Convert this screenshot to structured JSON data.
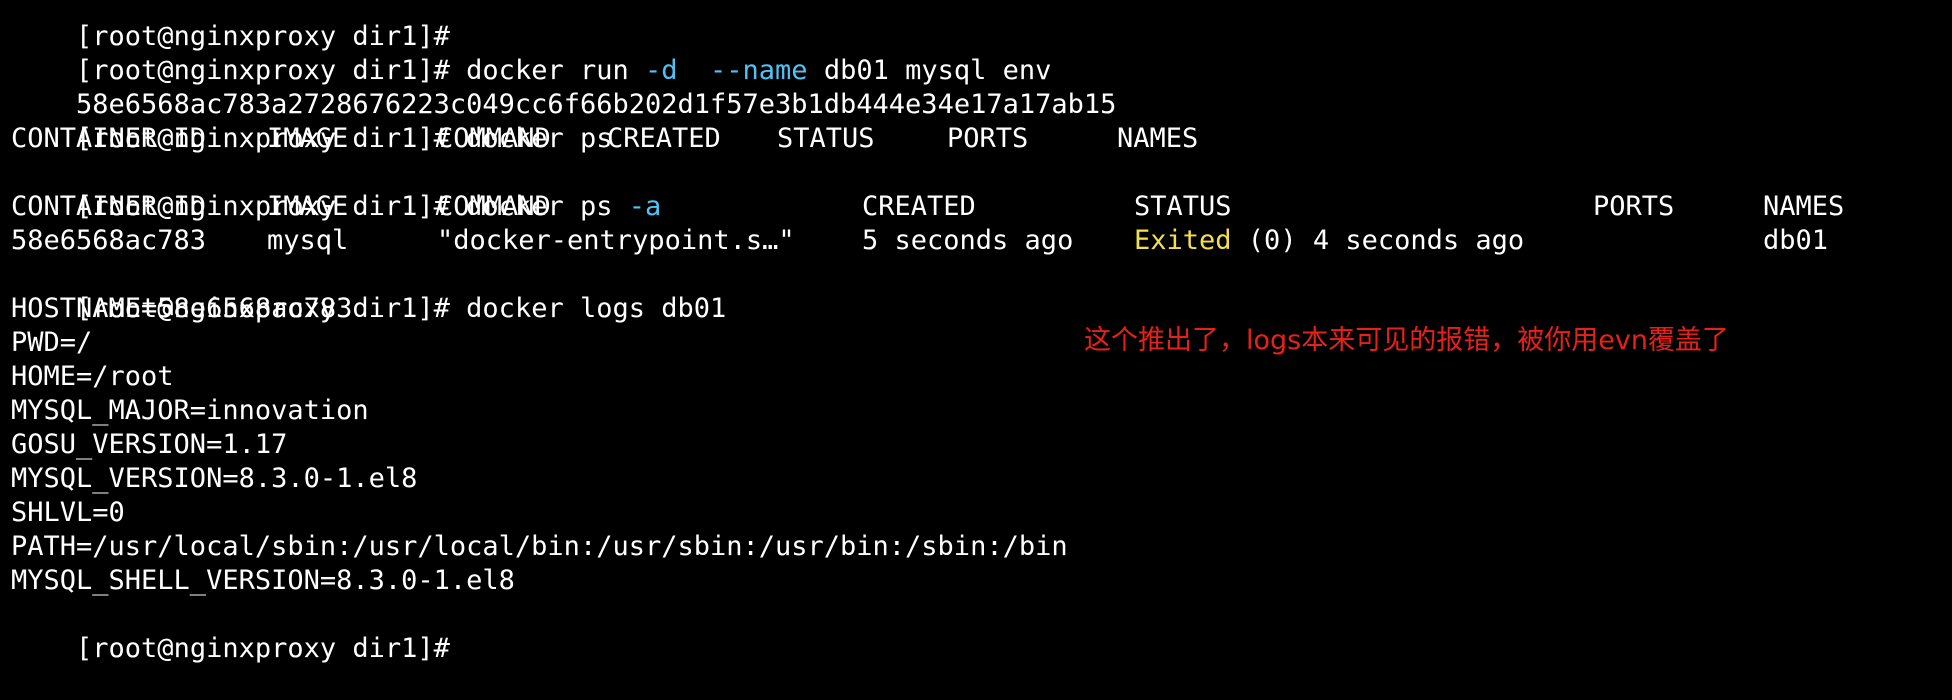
{
  "terminal": {
    "prompt": "[root@nginxproxy dir1]# ",
    "prompt_partial": "[root@nginxproxy dir1]# ",
    "cmd_run": {
      "prefix": "docker run ",
      "flag_d": "-d",
      "gap": "  ",
      "flag_name": "--name",
      "rest": " db01 mysql env"
    },
    "container_id_full": "58e6568ac783a2728676223c049cc6f66b202d1f57e3b1db444e34e17a17ab15",
    "cmd_ps": "docker ps",
    "ps_headers": {
      "container_id": "CONTAINER ID",
      "image": "IMAGE",
      "command": "COMMAND",
      "created": "CREATED",
      "status": "STATUS",
      "ports": "PORTS",
      "names": "NAMES"
    },
    "cmd_ps_a": {
      "prefix": "docker ps ",
      "flag_a": "-a"
    },
    "ps_a_row": {
      "container_id": "58e6568ac783",
      "image": "mysql",
      "command": "\"docker-entrypoint.s…\"",
      "created": "5 seconds ago",
      "status_word": "Exited",
      "status_rest": " (0) 4 seconds ago",
      "ports": "",
      "names": "db01"
    },
    "cmd_logs": "docker logs db01",
    "log_lines": [
      "HOSTNAME=58e6568ac783",
      "PWD=/",
      "HOME=/root",
      "MYSQL_MAJOR=innovation",
      "GOSU_VERSION=1.17",
      "MYSQL_VERSION=8.3.0-1.el8",
      "SHLVL=0",
      "PATH=/usr/local/sbin:/usr/local/bin:/usr/sbin:/usr/bin:/sbin:/bin",
      "MYSQL_SHELL_VERSION=8.3.0-1.el8"
    ],
    "prompt_last": "[root@nginxproxy dir1]#"
  },
  "annotation": {
    "text": "这个推出了，logs本来可见的报错，被你用evn覆盖了",
    "color": "#e8201a"
  },
  "colors": {
    "background": "#000000",
    "text": "#ffffff",
    "flag": "#4fc3f7",
    "exited": "#f4e04d"
  }
}
